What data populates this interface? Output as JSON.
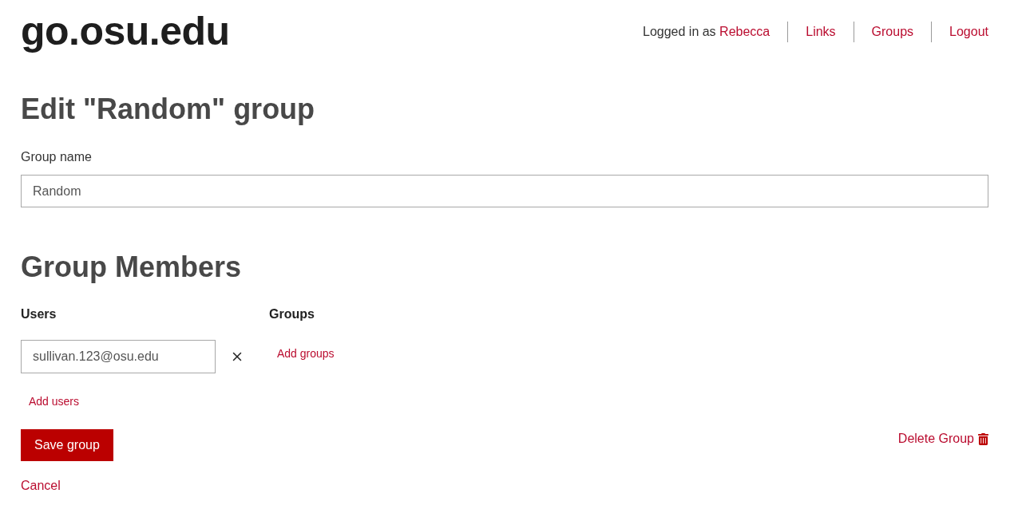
{
  "header": {
    "logo": "go.osu.edu",
    "login": {
      "prefix": "Logged in as",
      "name": "Rebecca"
    },
    "nav": [
      "Links",
      "Groups",
      "Logout"
    ]
  },
  "page_title": "Edit \"Random\" group",
  "group_name": {
    "label": "Group name",
    "value": "Random"
  },
  "members": {
    "title": "Group Members",
    "users": {
      "label": "Users",
      "entries": [
        "sullivan.123@osu.edu"
      ],
      "add_link": "Add users"
    },
    "groups": {
      "label": "Groups",
      "add_link": "Add groups"
    }
  },
  "actions": {
    "save": "Save group",
    "delete": "Delete Group",
    "cancel": "Cancel"
  }
}
